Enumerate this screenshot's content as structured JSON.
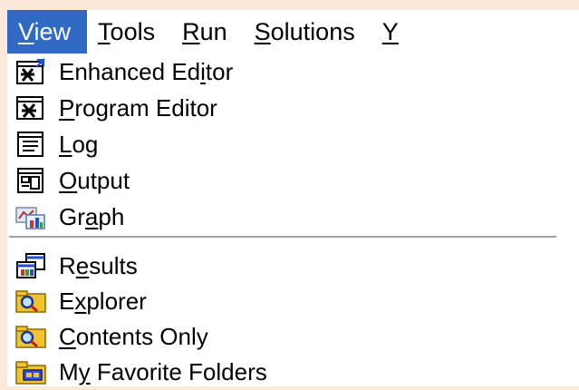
{
  "menubar": {
    "items": [
      {
        "label": "View",
        "access": "V",
        "rest": "iew"
      },
      {
        "label": "Tools",
        "access": "T",
        "rest": "ools"
      },
      {
        "label": "Run",
        "access": "R",
        "rest": "un"
      },
      {
        "label": "Solutions",
        "access": "S",
        "rest": "olutions"
      },
      {
        "label": "Y",
        "access": "Y",
        "rest": ""
      }
    ],
    "active_color": "#316ac5"
  },
  "view_menu": {
    "items": [
      {
        "pre": "Enhanced Ed",
        "acc": "i",
        "post": "tor",
        "icon": "enhanced-editor-icon"
      },
      {
        "pre": "",
        "acc": "P",
        "post": "rogram Editor",
        "icon": "program-editor-icon"
      },
      {
        "pre": "",
        "acc": "L",
        "post": "og",
        "icon": "log-icon"
      },
      {
        "pre": "",
        "acc": "O",
        "post": "utput",
        "icon": "output-icon"
      },
      {
        "pre": "Gr",
        "acc": "a",
        "post": "ph",
        "icon": "graph-icon"
      },
      {
        "pre": "R",
        "acc": "e",
        "post": "sults",
        "icon": "results-icon"
      },
      {
        "pre": "E",
        "acc": "x",
        "post": "plorer",
        "icon": "explorer-icon"
      },
      {
        "pre": "",
        "acc": "C",
        "post": "ontents Only",
        "icon": "contents-only-icon"
      },
      {
        "pre": "M",
        "acc": "y",
        "post": " Favorite Folders",
        "icon": "favorite-folders-icon"
      }
    ]
  },
  "colors": {
    "background": "#fde9d9",
    "menu": "#ffffff",
    "highlight": "#316ac5"
  }
}
